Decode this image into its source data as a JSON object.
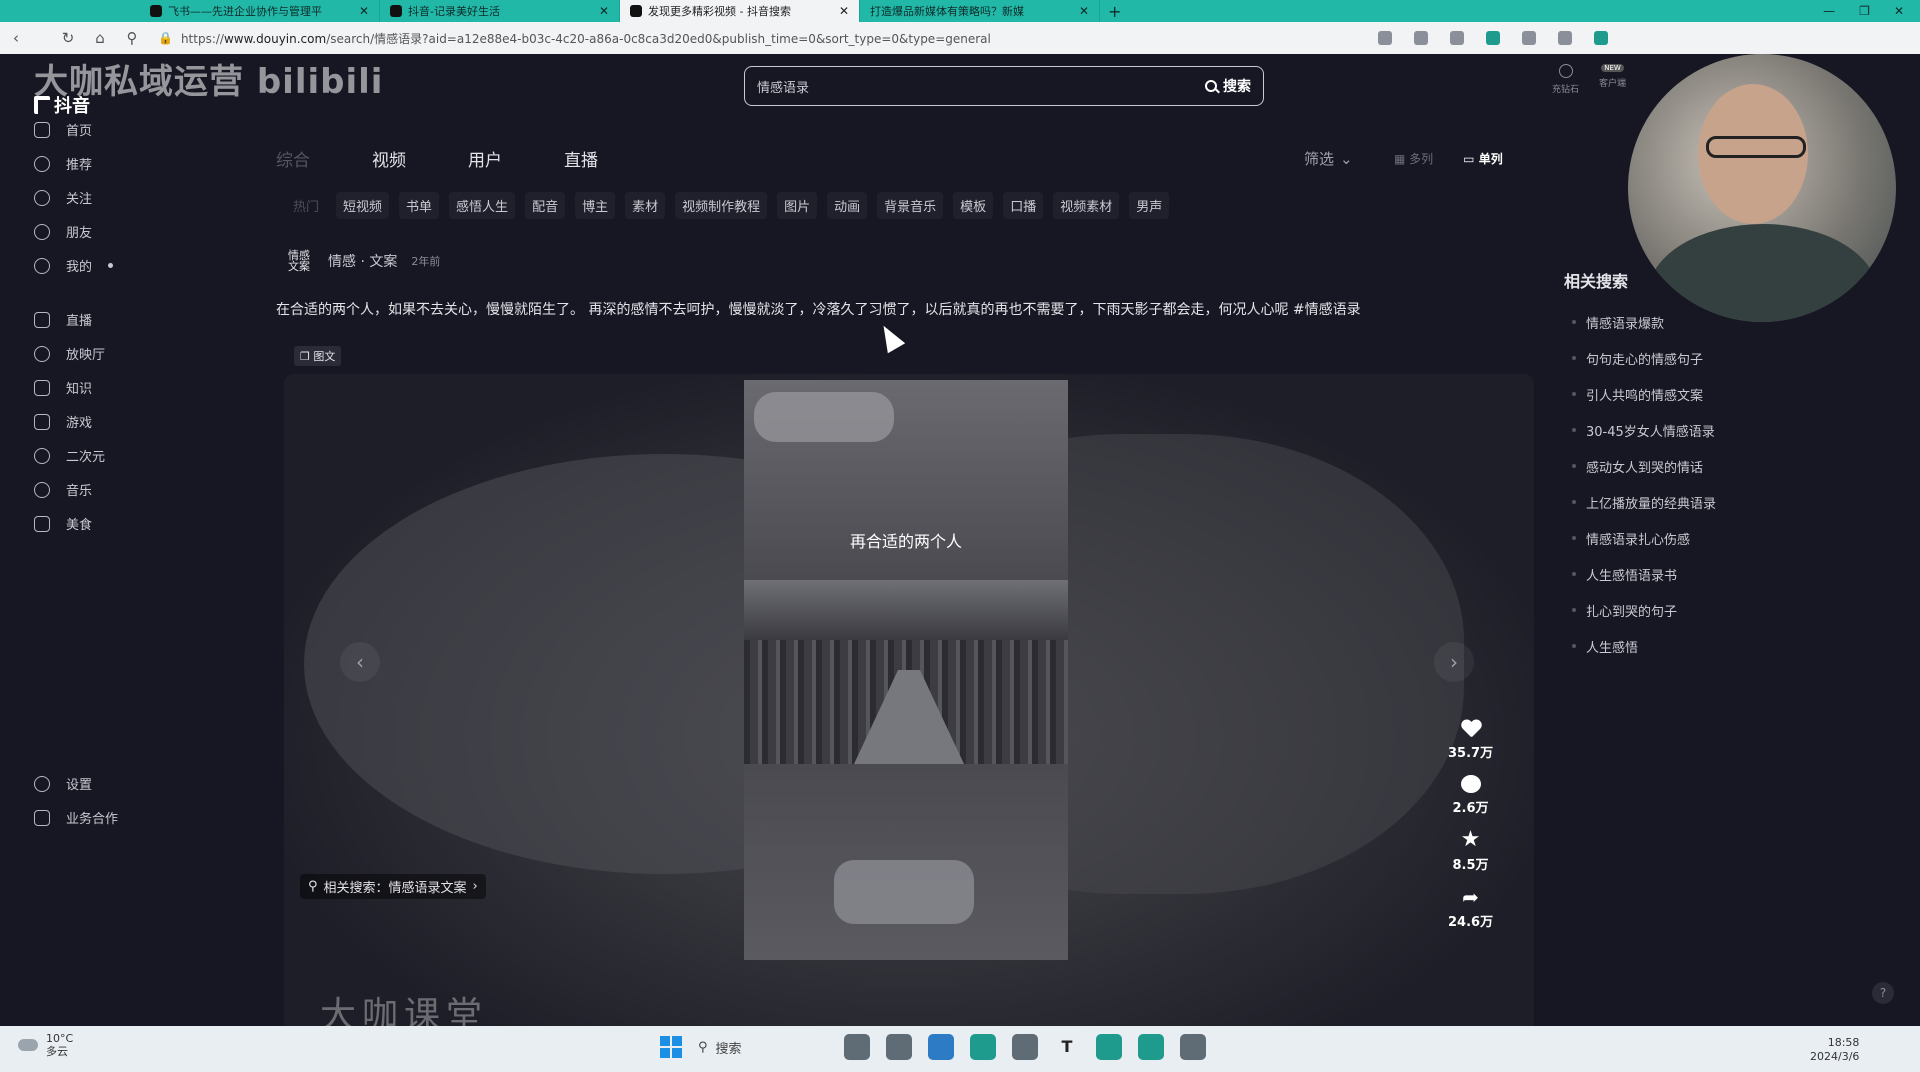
{
  "browser": {
    "tabs": [
      {
        "title": "飞书——先进企业协作与管理平"
      },
      {
        "title": "抖音-记录美好生活"
      },
      {
        "title": "发现更多精彩视频 - 抖音搜索"
      },
      {
        "title": "打造爆品新媒体有策略吗？新媒"
      }
    ],
    "url_prefix": "https://",
    "url_host": "www.douyin.com",
    "url_path": "/search/情感语录?aid=a12e88e4-b03c-4c20-a86a-0c8ca3d20ed0&publish_time=0&sort_type=0&type=general"
  },
  "watermark_top": "大咖私域运营  bilibili",
  "watermark_bottom": "大咖课堂",
  "logo_text": "抖音",
  "sidebar": {
    "items": [
      {
        "label": "首页",
        "icon": "home-icon"
      },
      {
        "label": "推荐",
        "icon": "recommend-icon"
      },
      {
        "label": "关注",
        "icon": "follow-icon"
      },
      {
        "label": "朋友",
        "icon": "friends-icon"
      },
      {
        "label": "我的",
        "icon": "profile-icon"
      },
      {
        "label": "直播",
        "icon": "live-icon"
      },
      {
        "label": "放映厅",
        "icon": "cinema-icon"
      },
      {
        "label": "知识",
        "icon": "knowledge-icon"
      },
      {
        "label": "游戏",
        "icon": "game-icon"
      },
      {
        "label": "二次元",
        "icon": "anime-icon"
      },
      {
        "label": "音乐",
        "icon": "music-icon"
      },
      {
        "label": "美食",
        "icon": "food-icon"
      }
    ],
    "bottom": [
      {
        "label": "设置",
        "icon": "settings-icon"
      },
      {
        "label": "业务合作",
        "icon": "business-icon"
      }
    ]
  },
  "search": {
    "value": "情感语录",
    "button": "搜索"
  },
  "header_tools": [
    {
      "label": "充钻石"
    },
    {
      "label": "客户端"
    }
  ],
  "header_badge": "NEW",
  "category_tabs": [
    "综合",
    "视频",
    "用户",
    "直播"
  ],
  "filter_label": "筛选",
  "view_options": [
    "多列",
    "单列"
  ],
  "sub_tags": [
    "短视频",
    "书单",
    "感悟人生",
    "配音",
    "博主",
    "素材",
    "视频制作教程",
    "图片",
    "动画",
    "背景音乐",
    "模板",
    "口播",
    "视频素材",
    "男声"
  ],
  "post": {
    "avatar_text": "情感文案",
    "author": "情感 · 文案",
    "time": "2年前",
    "description": "在合适的两个人，如果不去关心，慢慢就陌生了。 再深的感情不去呵护，慢慢就淡了，冷落久了习惯了，以后就真的再也不需要了，下雨天影子都会走，何况人心呢 #情感语录",
    "type_tag": "图文",
    "caption": "再合适的两个人",
    "related_search": "相关搜索：情感语录文案",
    "stats": {
      "likes": "35.7万",
      "comments": "2.6万",
      "favorites": "8.5万",
      "shares": "24.6万"
    }
  },
  "related": {
    "title": "相关搜索",
    "items": [
      "情感语录爆款",
      "句句走心的情感句子",
      "引人共鸣的情感文案",
      "30-45岁女人情感语录",
      "感动女人到哭的情话",
      "上亿播放量的经典语录",
      "情感语录扎心伤感",
      "人生感悟语录书",
      "扎心到哭的句子",
      "人生感悟"
    ]
  },
  "taskbar": {
    "temp": "10°C",
    "weather": "多云",
    "search": "搜索",
    "time": "18:58",
    "date": "2024/3/6"
  }
}
